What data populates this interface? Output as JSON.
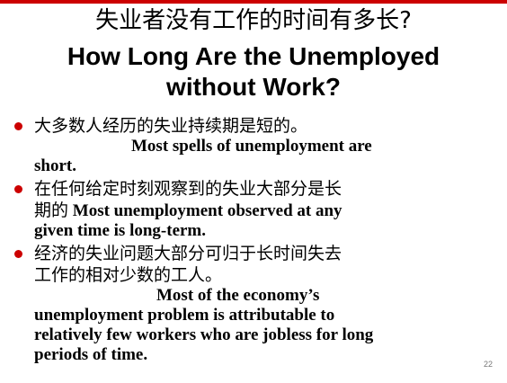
{
  "title": {
    "zh": "失业者没有工作的时间有多长?",
    "en_line1": "How Long Are the Unemployed",
    "en_line2": "without Work?"
  },
  "bullets": [
    {
      "zh": "大多数人经历的失业持续期是短的。",
      "en_line1": "Most spells of unemployment are",
      "en_line2": "short."
    },
    {
      "zh_line1": "在任何给定时刻观察到的失业大部分是长",
      "zh_line2": "期的",
      "en_inline": " Most unemployment observed at any",
      "en_line2": "given time is long-term."
    },
    {
      "zh_line1": "经济的失业问题大部分可归于长时间失去",
      "zh_line2": "工作的相对少数的工人。",
      "en_line1": "Most of the economy’s",
      "en_line2": "unemployment problem is attributable to",
      "en_line3": "relatively few workers who are jobless for long",
      "en_line4": "periods of time."
    }
  ],
  "slide_number": "22",
  "colors": {
    "bullet": "#cc0000",
    "text": "#000000",
    "slide_number": "#777777"
  }
}
